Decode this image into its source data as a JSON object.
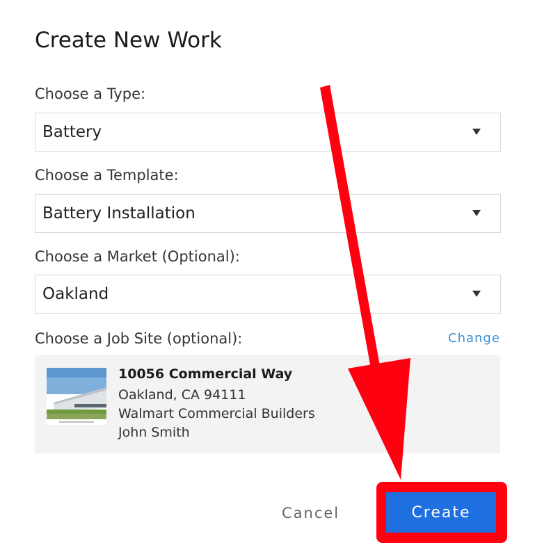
{
  "dialog": {
    "title": "Create New Work"
  },
  "type_field": {
    "label": "Choose a Type:",
    "value": "Battery"
  },
  "template_field": {
    "label": "Choose a Template:",
    "value": "Battery Installation"
  },
  "market_field": {
    "label": "Choose a Market (Optional):",
    "value": "Oakland"
  },
  "job_site": {
    "label": "Choose a Job Site (optional):",
    "change_label": "Change",
    "name": "10056 Commercial Way",
    "address": "Oakland, CA 94111",
    "company": "Walmart Commercial Builders",
    "contact": "John Smith"
  },
  "actions": {
    "cancel_label": "Cancel",
    "create_label": "Create"
  },
  "annotation": {
    "color": "#ff0010"
  },
  "colors": {
    "primary": "#1e6fe0",
    "link": "#3b8fd6"
  }
}
